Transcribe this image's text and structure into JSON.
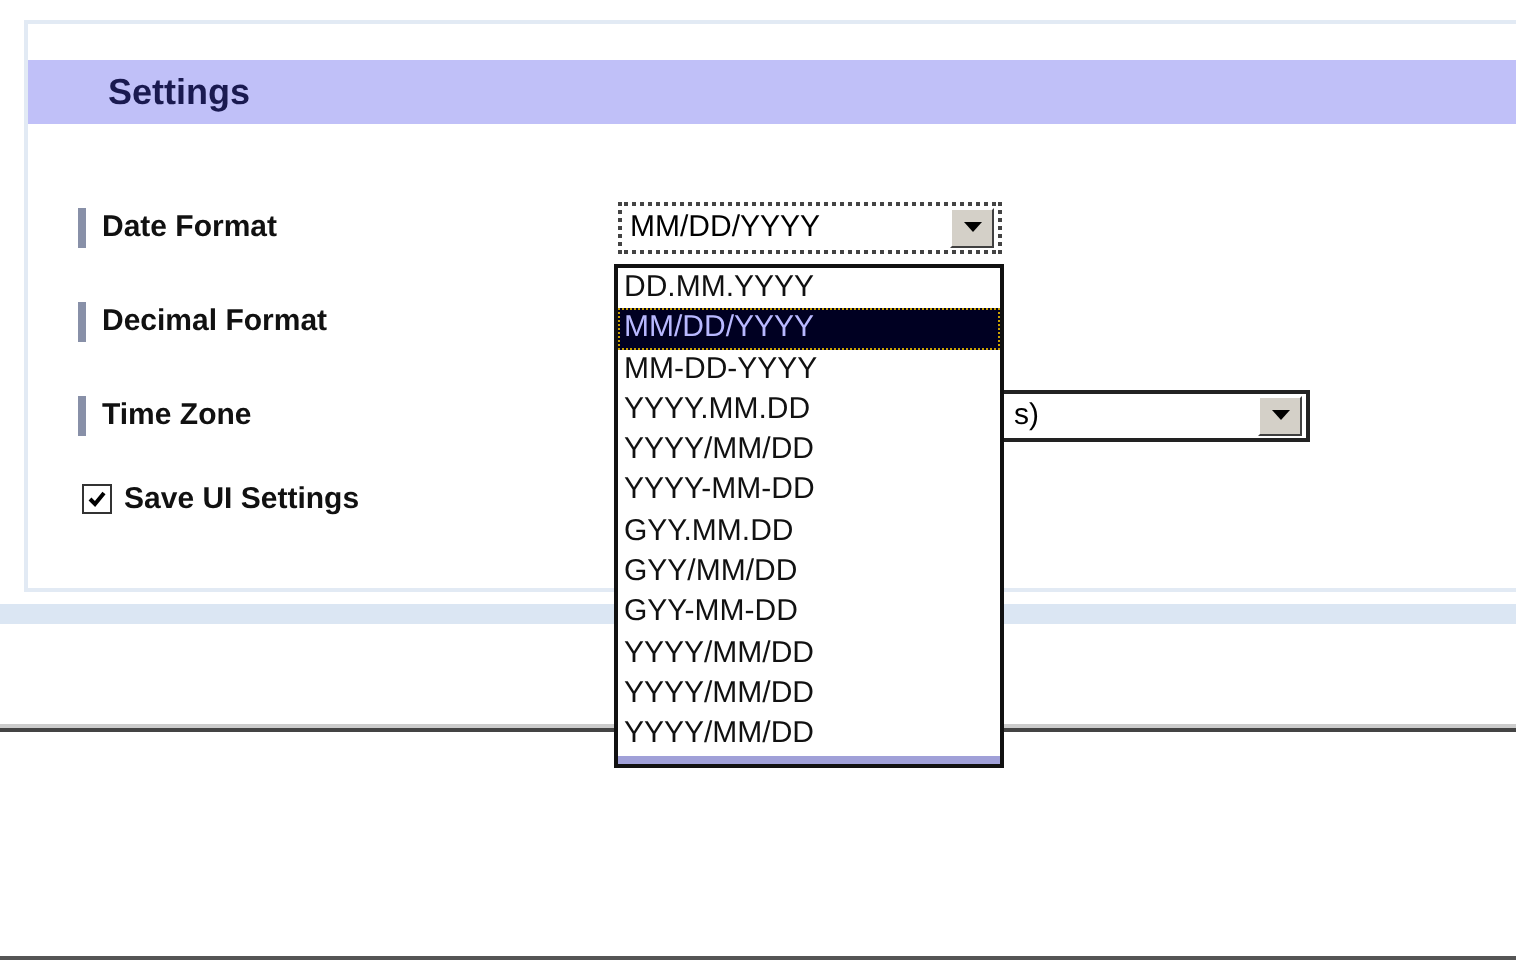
{
  "panel": {
    "title": "Settings"
  },
  "fields": [
    {
      "label": "Date Format",
      "kind": "select",
      "value": "MM/DD/YYYY"
    },
    {
      "label": "Decimal Format",
      "kind": "hidden"
    },
    {
      "label": "Time Zone",
      "kind": "select",
      "value": "s)"
    }
  ],
  "save_ui_settings": {
    "label": "Save UI Settings",
    "checked": true
  },
  "dropdown": {
    "options": [
      {
        "label": "DD.MM.YYYY",
        "selected": false
      },
      {
        "label": "MM/DD/YYYY",
        "selected": true
      },
      {
        "label": "MM-DD-YYYY",
        "selected": false
      },
      {
        "label": "YYYY.MM.DD",
        "selected": false
      },
      {
        "label": "YYYY/MM/DD",
        "selected": false
      },
      {
        "label": "YYYY-MM-DD",
        "selected": false
      },
      {
        "label": "GYY.MM.DD",
        "selected": false
      },
      {
        "label": "GYY/MM/DD",
        "selected": false
      },
      {
        "label": "GYY-MM-DD",
        "selected": false
      },
      {
        "label": "YYYY/MM/DD",
        "selected": false
      },
      {
        "label": "YYYY/MM/DD",
        "selected": false
      },
      {
        "label": "YYYY/MM/DD",
        "selected": false
      }
    ]
  }
}
